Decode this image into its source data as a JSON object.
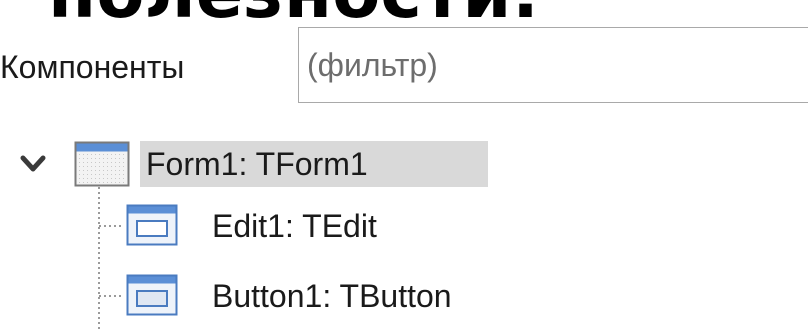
{
  "heading": {
    "text": "полезности:"
  },
  "filter": {
    "label": "Компоненты",
    "placeholder": "(фильтр)",
    "value": ""
  },
  "tree": {
    "root": {
      "label": "Form1: TForm1",
      "expanded": true,
      "selected": true,
      "icon": "form-icon"
    },
    "children": [
      {
        "label": "Edit1: TEdit",
        "icon": "edit-control-icon"
      },
      {
        "label": "Button1: TButton",
        "icon": "button-control-icon"
      }
    ]
  },
  "colors": {
    "selection": "#d9d9d9",
    "icon_title_bar": "#5b8fd6",
    "icon_border": "#4a7bc0",
    "tree_line": "#9a9a9a"
  }
}
